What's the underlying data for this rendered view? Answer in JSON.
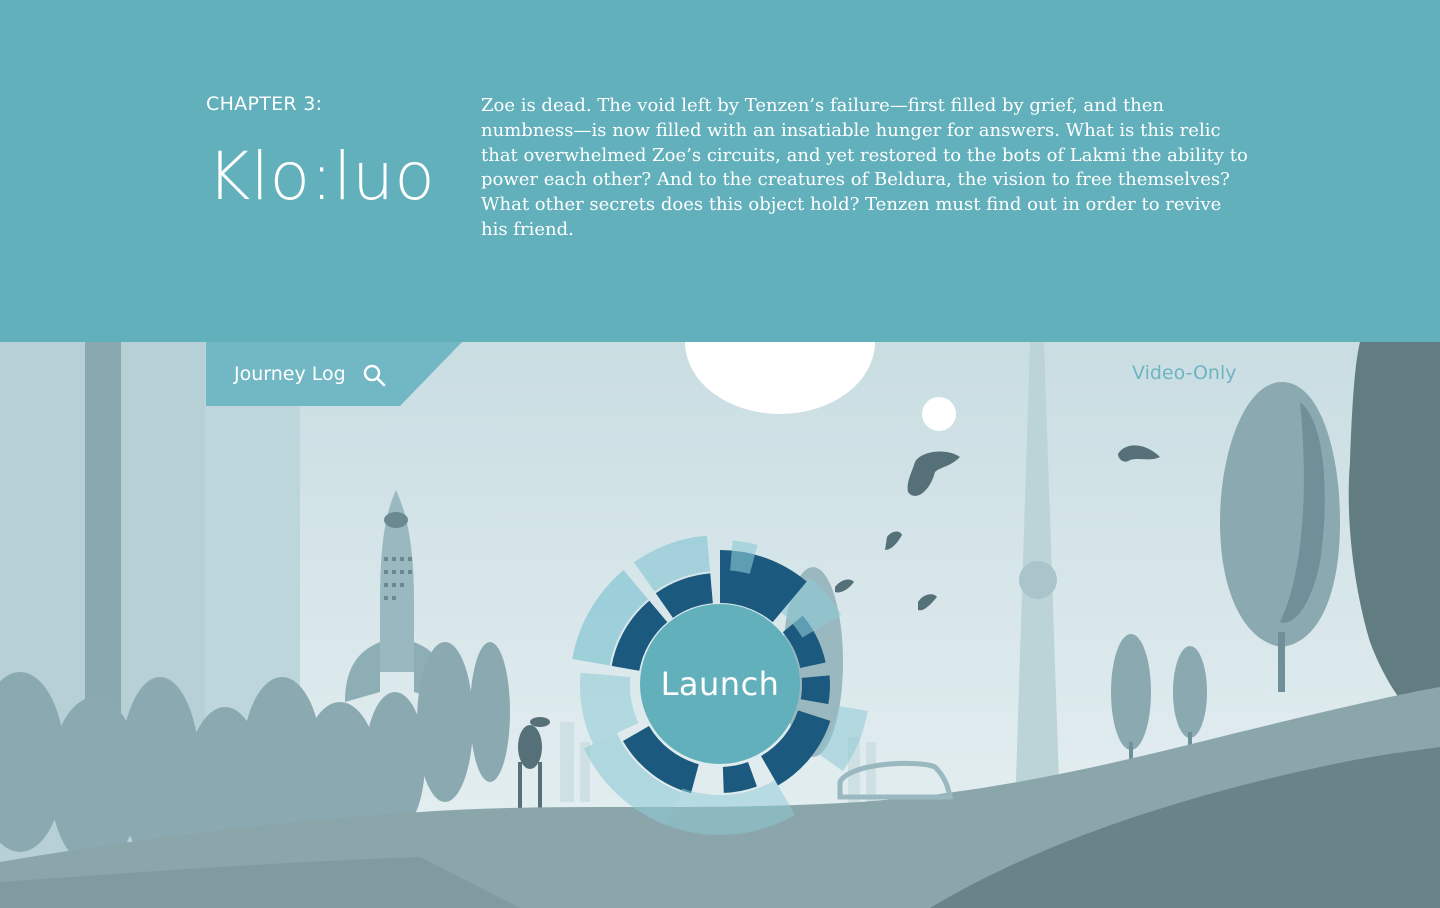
{
  "header": {
    "chapter_label": "CHAPTER 3:",
    "chapter_title": "Klo:luo",
    "description": "Zoe is dead. The void left by Tenzen’s failure—first filled by grief, and then numbness—is now filled with an insatiable hunger for answers. What is this relic that overwhelmed Zoe’s circuits, and yet restored to the bots of Lakmi the ability to power each other? And to the creatures of Beldura, the vision to free themselves? What other secrets does this object hold? Tenzen must find out in order to revive his friend."
  },
  "nav": {
    "journey_log_label": "Journey Log",
    "video_only_label": "Video-Only"
  },
  "launch": {
    "label": "Launch"
  },
  "icons": {
    "search": "search-icon",
    "launch_dial": "radial-dial-icon"
  },
  "colors": {
    "header_bg": "#62b0bc",
    "sky": "#d6e6ea",
    "dial_dark": "#1b5a7e",
    "dial_light": "#8ec9d6",
    "launch_button": "#62b0bc",
    "video_only_text": "#6fb4c0"
  }
}
